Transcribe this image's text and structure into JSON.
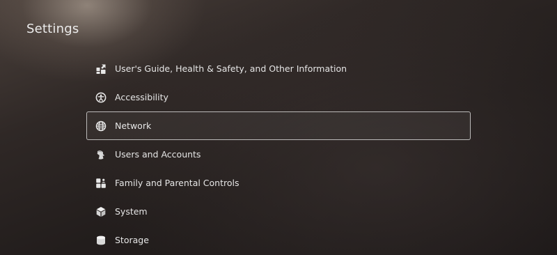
{
  "header": {
    "title": "Settings"
  },
  "menu": {
    "items": [
      {
        "label": "User's Guide, Health & Safety, and Other Information",
        "icon": "info-guide-icon",
        "selected": false
      },
      {
        "label": "Accessibility",
        "icon": "accessibility-icon",
        "selected": false
      },
      {
        "label": "Network",
        "icon": "globe-icon",
        "selected": true
      },
      {
        "label": "Users and Accounts",
        "icon": "user-icon",
        "selected": false
      },
      {
        "label": "Family and Parental Controls",
        "icon": "family-icon",
        "selected": false
      },
      {
        "label": "System",
        "icon": "cube-icon",
        "selected": false
      },
      {
        "label": "Storage",
        "icon": "database-icon",
        "selected": false
      }
    ]
  },
  "colors": {
    "text": "#e6e6e6",
    "selection_border": "#ebebeb"
  }
}
